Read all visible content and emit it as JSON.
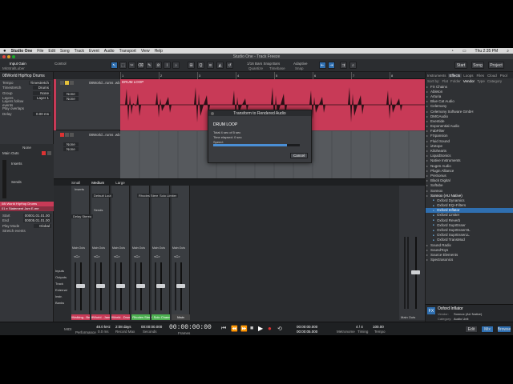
{
  "menubar": {
    "app_name": "Studio One",
    "items": [
      "File",
      "Edit",
      "Song",
      "Track",
      "Event",
      "Audio",
      "Transport",
      "View",
      "Help"
    ],
    "clock": "Thu 2:35 PM"
  },
  "window": {
    "title": "Studio One - Track Freeze"
  },
  "toolbar": {
    "input_gain_label": "Input Gain",
    "control_label": "Control",
    "device_name": "MkStrallLuber",
    "timebase_label": "Bars",
    "snap_label": "Snap",
    "snap_value": "1/16 Bars Snap",
    "quantize_label": "Quantize",
    "timebase": "Timebase",
    "adaptive": "Adaptive",
    "snap": "Snap",
    "start_button": "Start",
    "song_button": "Song",
    "project_button": "Project",
    "colors": {
      "accent": "#2f6fb0",
      "clip": "#c83a57"
    }
  },
  "inspector": {
    "track_name": "08World HipHop Drums",
    "rows": [
      {
        "label": "Tempo",
        "value": "Timestretch"
      },
      {
        "label": "Timestretch",
        "value": "Drums"
      },
      {
        "label": "Group",
        "value": "None"
      },
      {
        "label": "Layers",
        "value": "Layer 1"
      },
      {
        "label": "Layers follow events",
        "value": ""
      },
      {
        "label": "Play overlaps",
        "value": ""
      },
      {
        "label": "Delay",
        "value": "0.00 ms"
      }
    ],
    "channel_label": "None",
    "output": "Main Outs",
    "inserts_label": "Inserts",
    "sends_label": "Sends",
    "channel_name": "08i World HipHop Drums",
    "event_name": "01 e Statement Jam E-me",
    "event_rows": [
      {
        "label": "Start",
        "value": "00001.01.01.00"
      },
      {
        "label": "End",
        "value": "00005.01.01.00"
      },
      {
        "label": "Play Mode",
        "value": "Global"
      },
      {
        "label": "Stretch events",
        "value": ""
      }
    ]
  },
  "tracks": [
    {
      "name": "08World...rums .wb",
      "mode": "None",
      "color": "#c83a57"
    },
    {
      "name": "08World...rums .wb",
      "mode": "None",
      "color": "#4a4c50"
    }
  ],
  "arrange": {
    "clip_name": "DRUM LOOP",
    "bars": [
      "1",
      "2",
      "3",
      "4",
      "5",
      "6",
      "7",
      "8",
      "9"
    ]
  },
  "dialog": {
    "title": "Transform to Rendered Audio",
    "heading": "DRUM LOOP",
    "lines": [
      "Total 4 sec of 5 sec",
      "Time elapsed: 0 sec",
      "Speed:"
    ],
    "progress": 0.85,
    "cancel": "Cancel"
  },
  "browser": {
    "tabs": [
      "Instruments",
      "Effects",
      "Loops",
      "Files",
      "Cloud",
      "Pool"
    ],
    "selected_tab": "Effects",
    "sort_by": "Sort by:",
    "sort_options": [
      "Flat",
      "Folder",
      "Vendor",
      "Type",
      "Category"
    ],
    "items": [
      "FX Chains",
      "Ableton",
      "Arturia",
      "Blue Cat Audio",
      "Celemony",
      "Celemony Software GmbH",
      "DMGAudio",
      "Eventide",
      "Exponential Audio",
      "FabFilter",
      "FXpansion",
      "Fluid Sound",
      "iZotope",
      "Kilohearts",
      "LiquidSonics",
      "Native Instruments",
      "Nugen Audio",
      "Plugin Alliance",
      "PreSonus",
      "Black Digital",
      "Softube",
      "Sonnox"
    ],
    "open_folder": "Sonnox (AU Native)",
    "sub_items": [
      "Oxford Dynamics",
      "Oxford EQ+Filters",
      "Oxford Inflator",
      "Oxford Limiter",
      "Oxford Reverb",
      "Oxford SuprEsser",
      "Oxford SuprEsserHL",
      "Oxford SuprEsserLL",
      "Oxford TransMod"
    ],
    "selected_sub": "Oxford Inflator",
    "tail_items": [
      "Sound Radix",
      "SoundToys",
      "Source Elements",
      "Spectrasonics",
      "Synchro Arts Ltd"
    ],
    "footer": {
      "name": "Oxford Inflator",
      "vendor_label": "Vendor:",
      "vendor": "Sonnox (AU Native)",
      "category_label": "Category:",
      "category": "Audio Unit"
    }
  },
  "mixer": {
    "tabs": [
      "Small",
      "Medium",
      "Large"
    ],
    "routing": [
      "Inputs",
      "Outputs",
      "Track",
      "External",
      "Instr.",
      "Banks"
    ],
    "strips": [
      {
        "name": "08Walking...Beat",
        "color": "#c83a57",
        "level": 0.55,
        "pan": "<C>"
      },
      {
        "name": "08World...Jams",
        "color": "#c83a57",
        "level": 0.55,
        "pan": "<C>"
      },
      {
        "name": "08World...Drums",
        "color": "#c83a57",
        "level": 0.55,
        "pan": "<C>"
      },
      {
        "name": "FX Rhodes Stereo",
        "color": "#4caf50",
        "level": 0.55,
        "pan": "<C>"
      },
      {
        "name": "FX Solo Channel",
        "color": "#4caf50",
        "level": 0.55,
        "pan": "<C>"
      },
      {
        "name": "Main",
        "color": "#444",
        "level": 0.55,
        "pan": "<C>"
      }
    ],
    "inserts_label": "Inserts",
    "sends_label": "Sends",
    "main_outs": "Main Outs",
    "default_label": "Default Lout",
    "rhodes": "Rhodes Stereo",
    "solo": "Solo Limiter",
    "delay": "Delay Stereo",
    "main_label": "Main Outs"
  },
  "transport": {
    "midi": "MIDI",
    "performance": "Performance",
    "sample_rate": "48.0 kHz",
    "sample_rate2": "0.0 ms",
    "record_max": "2:08 days",
    "record_label": "Record Max",
    "seconds_label": "Seconds",
    "time": "00:00:00:00",
    "time_label": "Frames",
    "position": "00:00:00.000",
    "position2": "00:00:05.000",
    "metronome": "Metronome",
    "signature": "4 / 4",
    "timing": "Timing",
    "tempo": "100.00",
    "tempo_label": "Tempo",
    "edit": "Edit",
    "mix": "Mix",
    "browse": "Browse"
  }
}
